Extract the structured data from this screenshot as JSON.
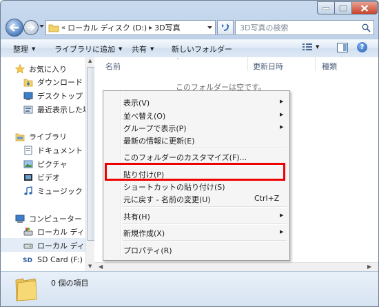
{
  "nav": {
    "breadcrumb": {
      "overflow": "«",
      "drive": "ローカル ディスク (D:)",
      "separator": "▸",
      "folder": "3D写真"
    },
    "search_placeholder": "3D写真の検索"
  },
  "toolbar": {
    "organize": "整理",
    "include_in_library": "ライブラリに追加",
    "share": "共有",
    "new_folder": "新しいフォルダー",
    "help": "?"
  },
  "navpane": {
    "favorites": "お気に入り",
    "downloads": "ダウンロード",
    "desktop": "デスクトップ",
    "recent": "最近表示した場所",
    "libraries": "ライブラリ",
    "documents": "ドキュメント",
    "pictures": "ピクチャ",
    "videos": "ビデオ",
    "music": "ミュージック",
    "computer": "コンピューター",
    "local_disk_c": "ローカル ディスク",
    "local_disk_d": "ローカル ディスク",
    "sd_card": "SD Card (F:)"
  },
  "columns": {
    "name": "名前",
    "date": "更新日時",
    "type": "種類"
  },
  "empty_message": "このフォルダーは空です。",
  "context_menu": {
    "view": "表示(V)",
    "sort_by": "並べ替え(O)",
    "group_by": "グループで表示(P)",
    "refresh": "最新の情報に更新(E)",
    "customize": "このフォルダーのカスタマイズ(F)...",
    "paste": "貼り付け(P)",
    "paste_shortcut": "ショートカットの貼り付け(S)",
    "undo_rename": "元に戻す - 名前の変更(U)",
    "undo_shortcut": "Ctrl+Z",
    "share": "共有(H)",
    "new": "新規作成(X)",
    "properties": "プロパティ(R)"
  },
  "details": {
    "item_count": "0 個の項目"
  },
  "colors": {
    "highlight_border": "#ee0000",
    "folder_yellow": "#f3d36b"
  }
}
